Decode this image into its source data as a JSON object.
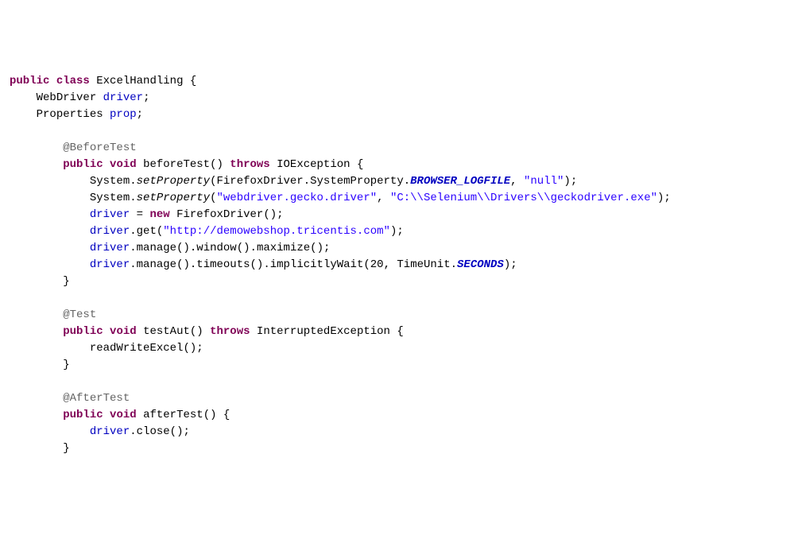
{
  "kw": {
    "public": "public",
    "class": "class",
    "void": "void",
    "throws": "throws",
    "new": "new"
  },
  "cls": {
    "name": "ExcelHandling",
    "WebDriver": "WebDriver",
    "Properties": "Properties",
    "IOException": "IOException",
    "System": "System",
    "FirefoxDriver": "FirefoxDriver",
    "SystemProperty": "SystemProperty",
    "TimeUnit": "TimeUnit",
    "InterruptedException": "InterruptedException"
  },
  "fld": {
    "driver": "driver",
    "prop": "prop"
  },
  "ann": {
    "BeforeTest": "@BeforeTest",
    "Test": "@Test",
    "AfterTest": "@AfterTest"
  },
  "m": {
    "beforeTest": "beforeTest",
    "setProperty": "setProperty",
    "get": "get",
    "manage": "manage",
    "window": "window",
    "maximize": "maximize",
    "timeouts": "timeouts",
    "implicitlyWait": "implicitlyWait",
    "testAut": "testAut",
    "readWriteExcel": "readWriteExcel",
    "afterTest": "afterTest",
    "close": "close"
  },
  "sf": {
    "BROWSER_LOGFILE": "BROWSER_LOGFILE",
    "SECONDS": "SECONDS"
  },
  "str": {
    "nullStr": "\"null\"",
    "geckoKey": "\"webdriver.gecko.driver\"",
    "geckoPath": "\"C:\\\\Selenium\\\\Drivers\\\\geckodriver.exe\"",
    "url": "\"http://demowebshop.tricentis.com\""
  },
  "num": {
    "twenty": "20"
  },
  "p": {
    "op": "(",
    "cp": ")",
    "ob": "{",
    "cb": "}",
    "sc": ";",
    "c": ",",
    "d": ".",
    "sp": " ",
    "eq": "="
  }
}
